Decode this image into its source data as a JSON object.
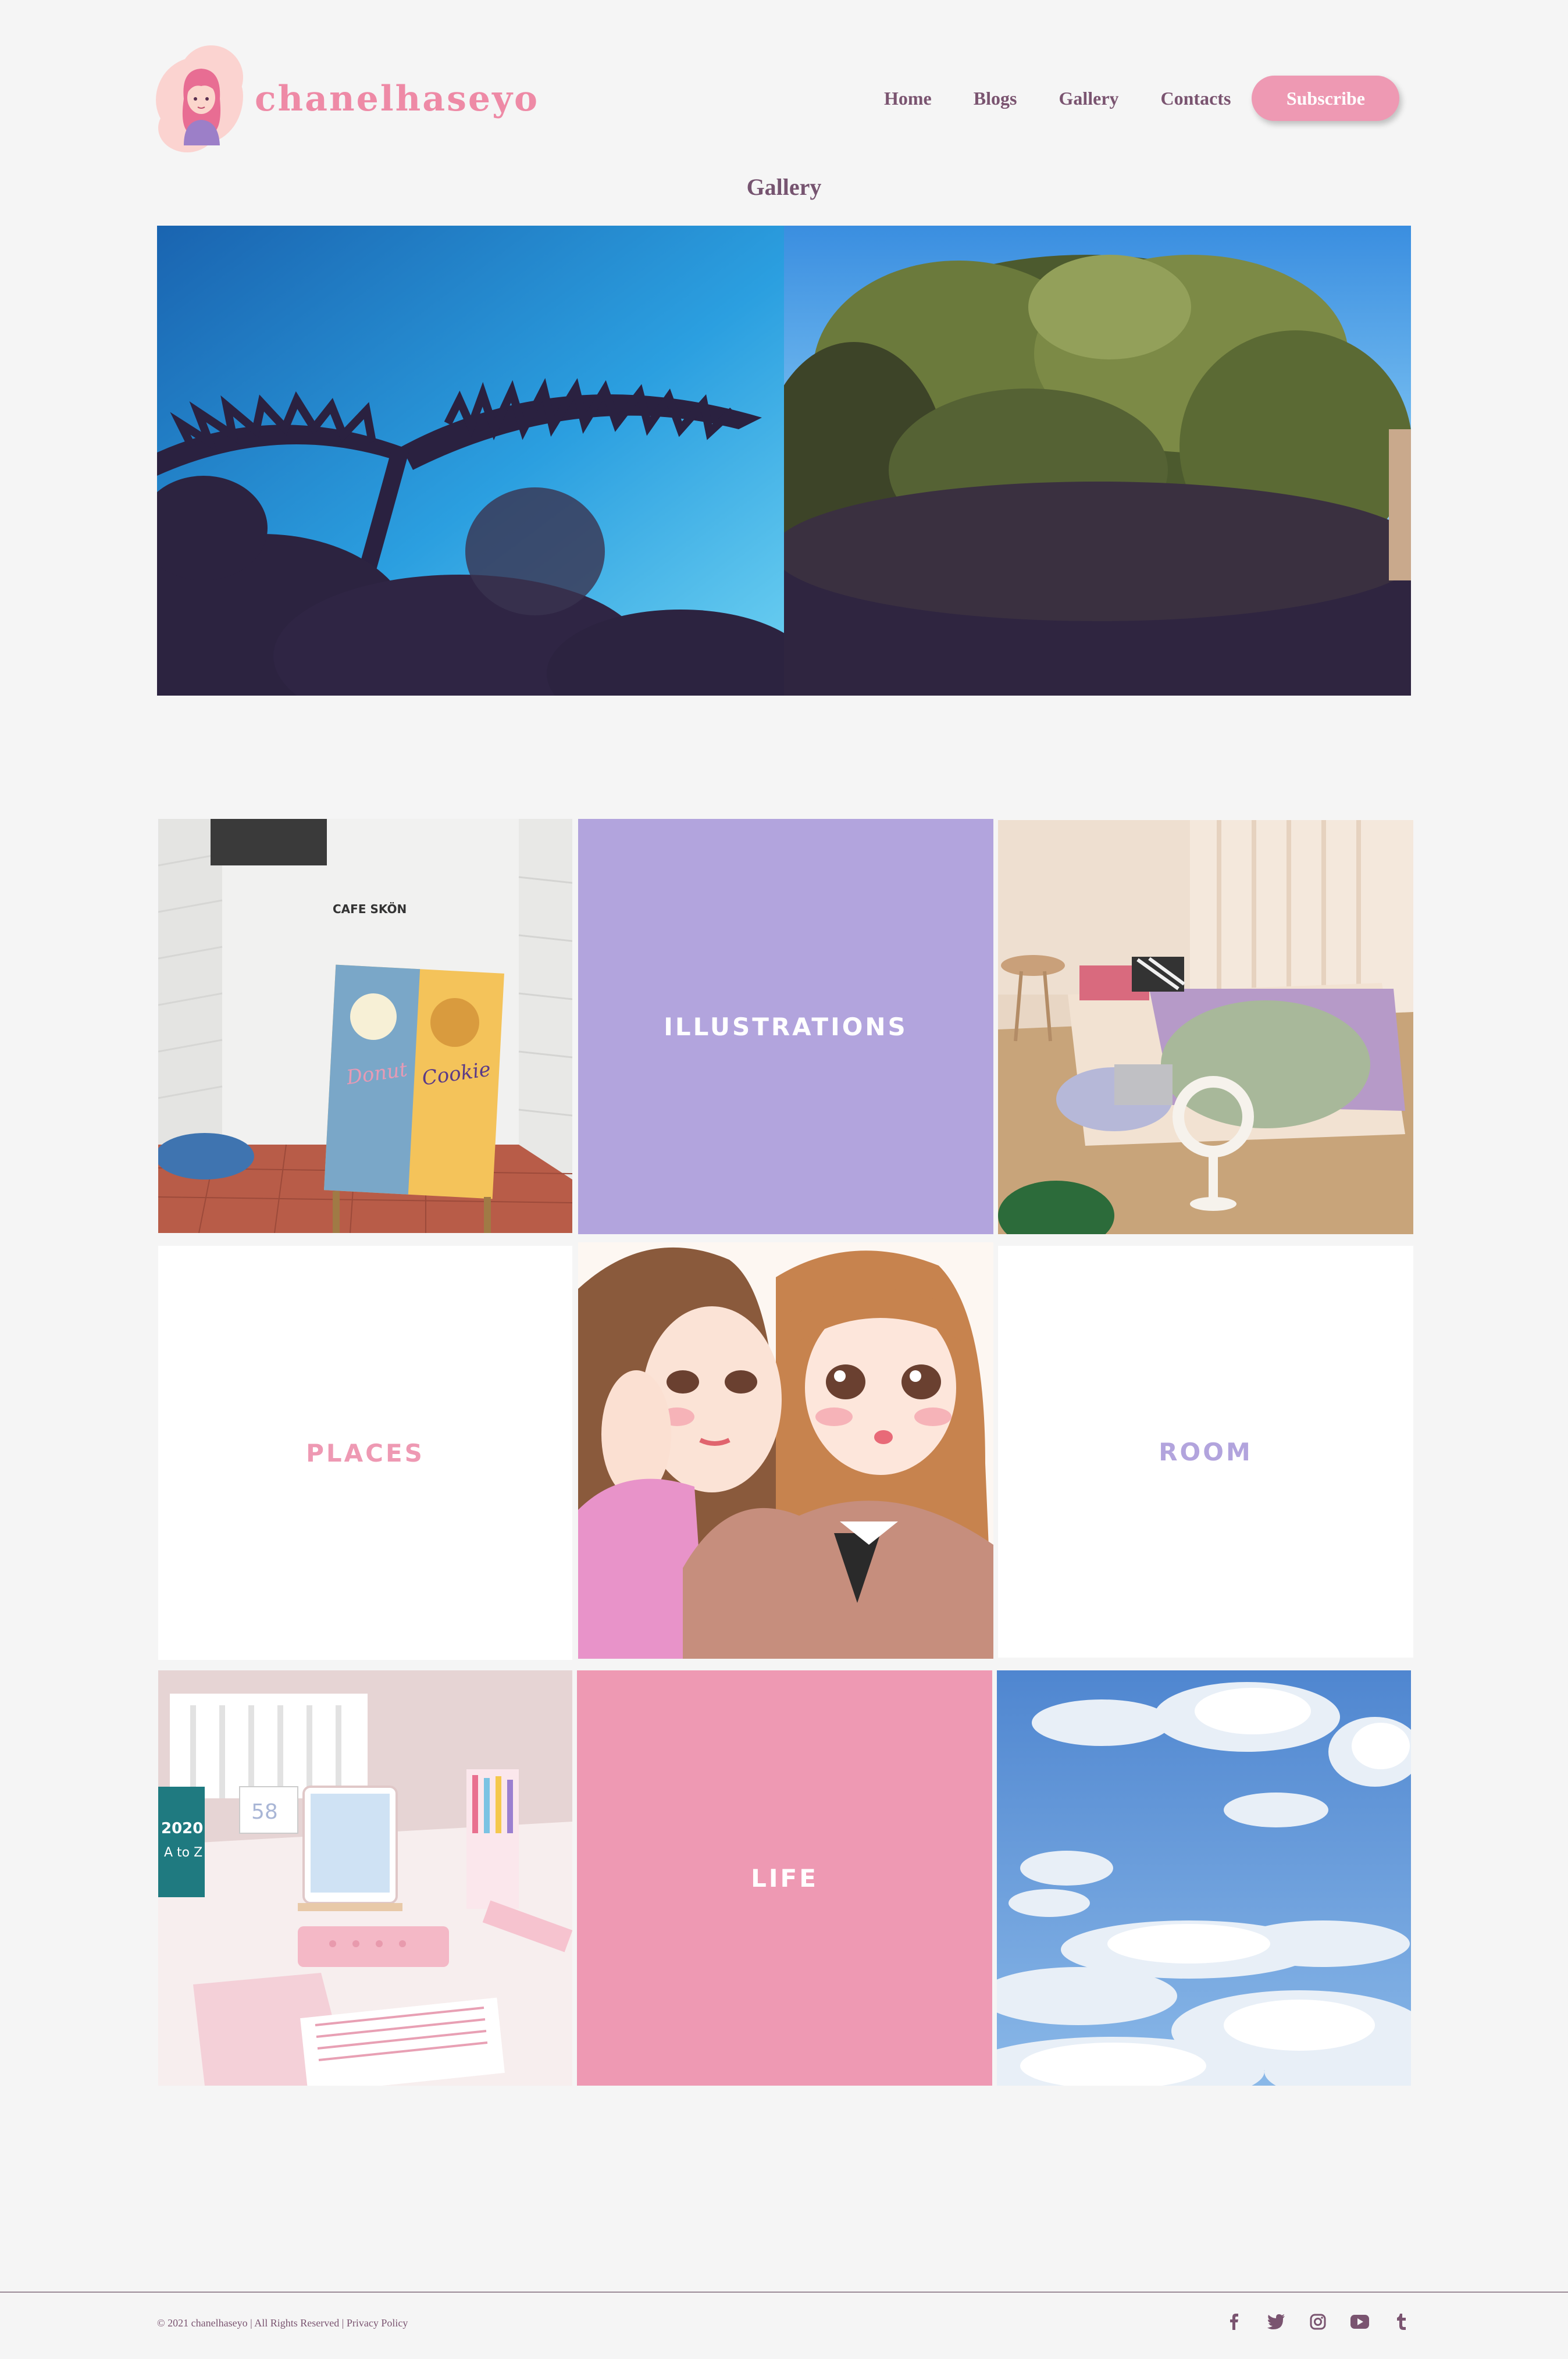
{
  "brand": {
    "name": "chanelhaseyo",
    "color": "#ee8aa6"
  },
  "nav": {
    "links": [
      "Home",
      "Blogs",
      "Gallery",
      "Contacts"
    ],
    "subscribe_label": "Subscribe",
    "active": "Gallery"
  },
  "page": {
    "title": "Gallery"
  },
  "hero": {
    "photos": [
      {
        "icon": "palm-sky-photo"
      },
      {
        "icon": "tree-sky-photo"
      }
    ]
  },
  "grid": {
    "tiles": [
      {
        "kind": "photo",
        "icon": "cafe-sign-photo",
        "sign_text": "CAFE SKÖN",
        "sign_left": "Donut",
        "sign_right": "Cookie"
      },
      {
        "kind": "label",
        "label": "ILLUSTRATIONS",
        "bg": "#b2a4dd",
        "color": "#ffffff"
      },
      {
        "kind": "photo",
        "icon": "bedroom-photo"
      },
      {
        "kind": "label",
        "label": "PLACES",
        "bg": "#ffffff",
        "color": "#ee99b3"
      },
      {
        "kind": "photo",
        "icon": "two-girls-illustration"
      },
      {
        "kind": "label",
        "label": "ROOM",
        "bg": "#ffffff",
        "color": "#b2a4dd"
      },
      {
        "kind": "photo",
        "icon": "desk-setup-photo",
        "calendar_text": "2020",
        "calendar_sub": "A to Z",
        "date": "58"
      },
      {
        "kind": "label",
        "label": "LIFE",
        "bg": "#ee99b3",
        "color": "#ffffff"
      },
      {
        "kind": "photo",
        "icon": "cloudy-sky-photo"
      }
    ]
  },
  "footer": {
    "copyright": "© 2021 chanelhaseyo | All Rights Reserved |",
    "privacy_label": "Privacy Policy",
    "socials": [
      "facebook-icon",
      "twitter-icon",
      "instagram-icon",
      "youtube-icon",
      "tumblr-icon"
    ]
  },
  "colors": {
    "accent": "#ee99b3",
    "lavender": "#b2a4dd",
    "nav_text": "#7a5470",
    "background": "#f5f5f5"
  }
}
